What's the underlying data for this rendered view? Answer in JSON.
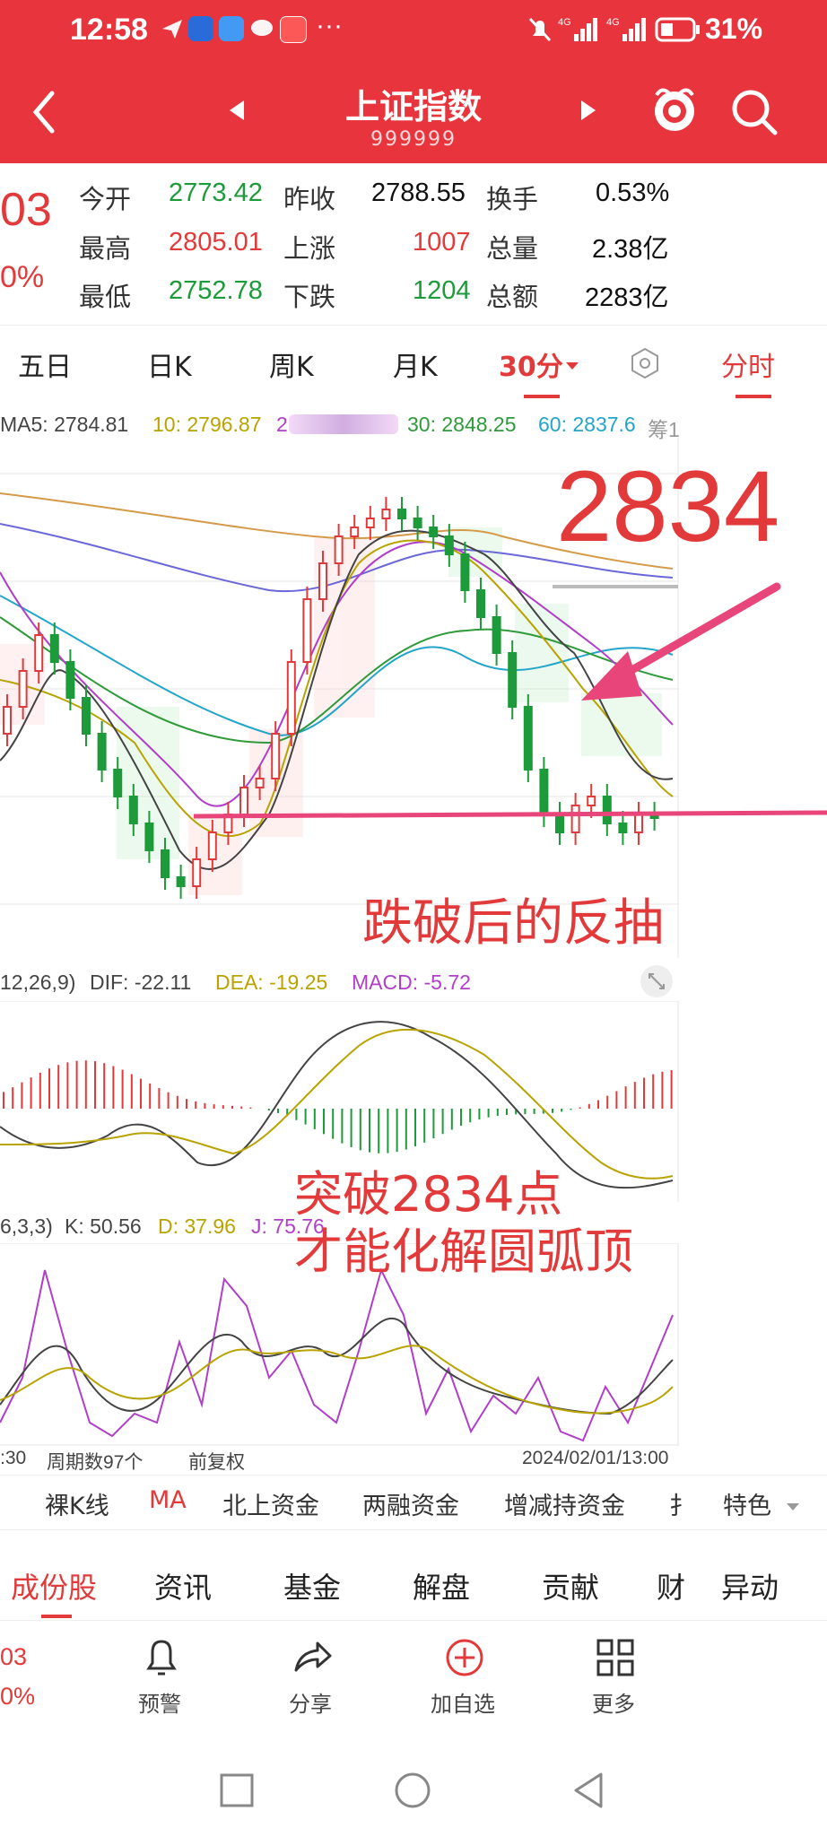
{
  "status_bar": {
    "time": "12:58",
    "battery": "31%"
  },
  "header": {
    "title": "上证指数",
    "code": "999999"
  },
  "price": {
    "partial_value": "03",
    "partial_pct": "0%"
  },
  "stats": {
    "jinkai_label": "今开",
    "jinkai": "2773.42",
    "zuoshou_label": "昨收",
    "zuoshou": "2788.55",
    "huanshou_label": "换手",
    "huanshou": "0.53%",
    "zuigao_label": "最高",
    "zuigao": "2805.01",
    "shangzhang_label": "上涨",
    "shangzhang": "1007",
    "zongliang_label": "总量",
    "zongliang": "2.38亿",
    "zuidi_label": "最低",
    "zuidi": "2752.78",
    "xiadie_label": "下跌",
    "xiadie": "1204",
    "zonge_label": "总额",
    "zonge": "2283亿"
  },
  "period_tabs": [
    "五日",
    "日K",
    "周K",
    "月K",
    "30分",
    "分时"
  ],
  "ma_legend": {
    "ma5": "MA5: 2784.81",
    "ma10": "10: 2796.87",
    "ma20": "2",
    "ma30": "30: 2848.25",
    "ma60": "60: 2837.6",
    "extra": "筹1"
  },
  "annotations": {
    "level": "2834",
    "rebound": "跌破后的反抽",
    "break1": "突破2834点",
    "break2": "才能化解圆弧顶"
  },
  "macd_legend": {
    "params": "12,26,9)",
    "dif": "DIF: -22.11",
    "dea": "DEA: -19.25",
    "macd": "MACD: -5.72"
  },
  "kdj_legend": {
    "params": "6,3,3)",
    "k": "K: 50.56",
    "d": "D: 37.96",
    "j": "J: 75.76"
  },
  "chart_footer": {
    "time_left": ":30",
    "periods": "周期数97个",
    "fuquan": "前复权",
    "datetime": "2024/02/01/13:00"
  },
  "indicator_tabs": [
    "裸K线",
    "MA",
    "北上资金",
    "两融资金",
    "增减持资金",
    "扌",
    "特色"
  ],
  "bottom_tabs": [
    "成份股",
    "资讯",
    "基金",
    "解盘",
    "贡献",
    "财",
    "异动"
  ],
  "mini_price": {
    "value": "03",
    "pct": "0%"
  },
  "actions": [
    "预警",
    "分享",
    "加自选",
    "更多"
  ],
  "colors": {
    "brand_red": "#e8343c",
    "up_red": "#e23a3a",
    "down_green": "#1d9a3a",
    "annotation_pink": "#e8457a"
  }
}
